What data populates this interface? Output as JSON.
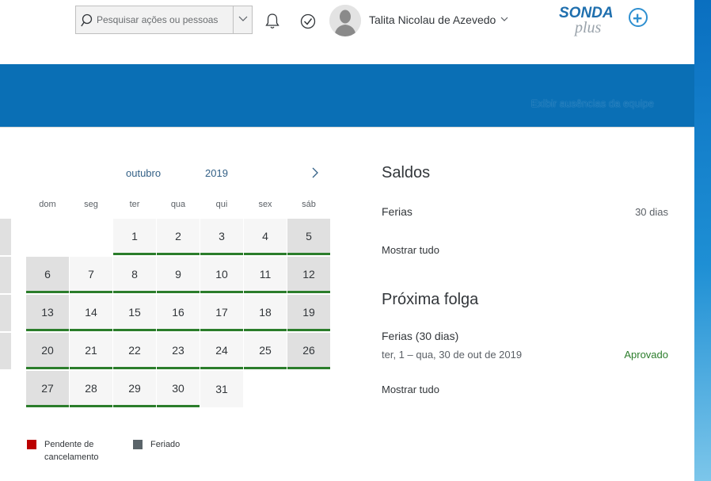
{
  "header": {
    "search_placeholder": "Pesquisar ações ou pessoas",
    "user_name": "Talita Nicolau de Azevedo",
    "logo_text": "SONDA",
    "logo_sub": "plus",
    "logo_symbol": "+"
  },
  "band": {
    "team_absences_link": "Exibir ausências da equipe"
  },
  "calendar": {
    "month": "outubro",
    "year": "2019",
    "weekdays": [
      "dom",
      "seg",
      "ter",
      "qua",
      "qui",
      "sex",
      "sáb"
    ],
    "days": [
      "1",
      "2",
      "3",
      "4",
      "5",
      "6",
      "7",
      "8",
      "9",
      "10",
      "11",
      "12",
      "13",
      "14",
      "15",
      "16",
      "17",
      "18",
      "19",
      "20",
      "21",
      "22",
      "23",
      "24",
      "25",
      "26",
      "27",
      "28",
      "29",
      "30",
      "31"
    ],
    "legend": {
      "pending_cancel_line1": "Pendente de",
      "pending_cancel_line2": "cancelamento",
      "holiday": "Feriado"
    }
  },
  "balances": {
    "title": "Saldos",
    "item_label": "Ferias",
    "item_value": "30 dias",
    "show_all": "Mostrar tudo"
  },
  "next_leave": {
    "title": "Próxima folga",
    "item_title": "Ferias (30 dias)",
    "item_dates": "ter, 1 – qua, 30 de out de 2019",
    "item_status": "Aprovado",
    "show_all": "Mostrar tudo"
  },
  "colors": {
    "brand_blue": "#0a6fb5",
    "approved_green": "#2b7d2b",
    "pending_red": "#bb0000",
    "holiday_gray": "#5a6469"
  }
}
